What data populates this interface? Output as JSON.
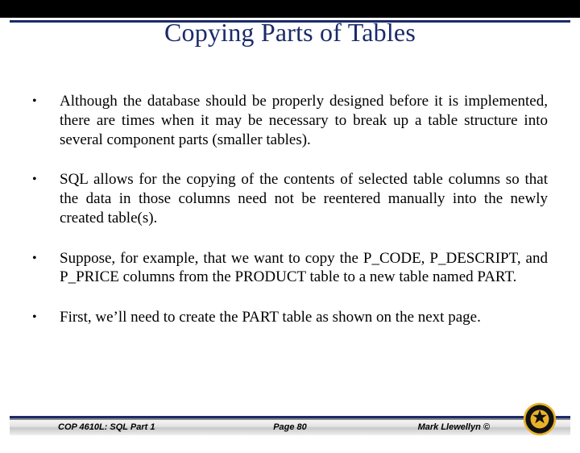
{
  "title": "Copying Parts of Tables",
  "bullets": [
    "Although the database should be properly designed before it is implemented, there are times when it may be necessary to break up a table structure into several component parts (smaller tables).",
    "SQL allows for the copying of the contents of selected table columns so that the data in those columns need not be reentered manually into the newly created table(s).",
    "Suppose, for example, that we want to copy the P_CODE, P_DESCRIPT, and P_PRICE columns from the PRODUCT table to a new table named PART.",
    "First, we’ll need to create the PART table as shown on the next page."
  ],
  "footer": {
    "left": "COP 4610L: SQL Part 1",
    "center": "Page 80",
    "right": "Mark Llewellyn ©"
  }
}
